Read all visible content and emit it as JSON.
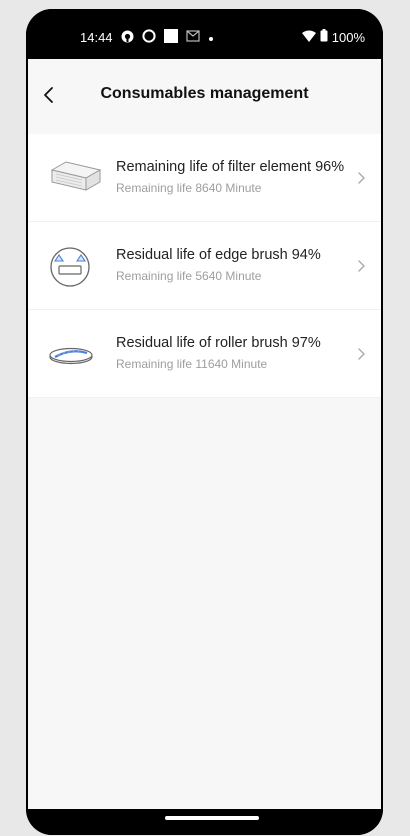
{
  "status_bar": {
    "time": "14:44",
    "battery": "100%",
    "icons_left": [
      "notification-app-icon",
      "circle-icon",
      "square-icon",
      "mail-icon",
      "dot-icon"
    ],
    "icons_right": [
      "wifi-icon",
      "battery-icon"
    ]
  },
  "header": {
    "title": "Consumables management",
    "back_icon": "chevron-left-icon"
  },
  "consumables": [
    {
      "title": "Remaining life of filter element 96%",
      "subtitle": "Remaining life 8640 Minute",
      "icon": "filter-element-icon"
    },
    {
      "title": "Residual life of edge brush 94%",
      "subtitle": "Remaining life 5640 Minute",
      "icon": "edge-brush-icon"
    },
    {
      "title": "Residual life of roller brush 97%",
      "subtitle": "Remaining life 11640 Minute",
      "icon": "roller-brush-icon"
    }
  ],
  "colors": {
    "background": "#f7f7f7",
    "card": "#ffffff",
    "title_text": "#111111",
    "subtitle_text": "#9e9e9e",
    "icon_accent": "#4a7fd9"
  }
}
